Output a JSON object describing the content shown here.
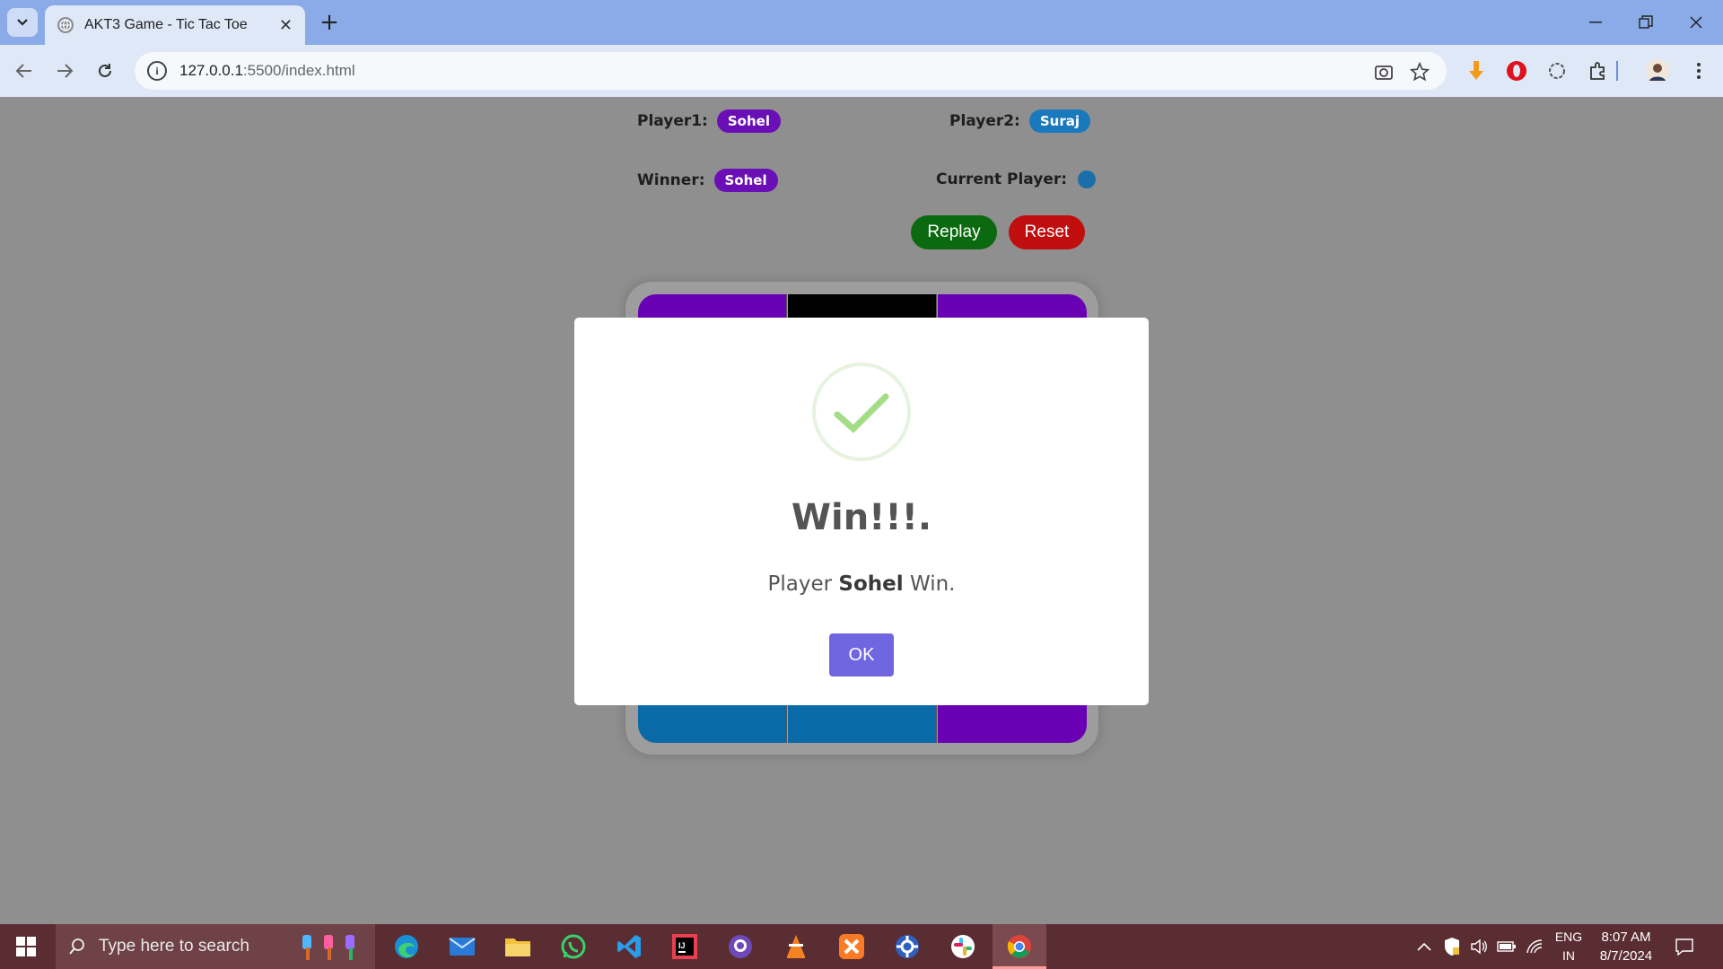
{
  "browser": {
    "tab_title": "AKT3 Game - Tic Tac Toe",
    "url_host": "127.0.0.1",
    "url_rest": ":5500/index.html"
  },
  "game": {
    "player1_label": "Player1:",
    "player1_name": "Sohel",
    "player2_label": "Player2:",
    "player2_name": "Suraj",
    "winner_label": "Winner:",
    "winner_name": "Sohel",
    "current_player_label": "Current Player:",
    "replay_label": "Replay",
    "reset_label": "Reset",
    "board_colors": {
      "player1": "#6a00b3",
      "player2": "#0a6aa8",
      "empty": "#000000"
    }
  },
  "modal": {
    "title": "Win!!!.",
    "text_prefix": "Player ",
    "text_name": "Sohel",
    "text_suffix": " Win.",
    "ok_label": "OK"
  },
  "taskbar": {
    "search_placeholder": "Type here to search",
    "lang_line1": "ENG",
    "lang_line2": "IN",
    "time": "8:07 AM",
    "date": "8/7/2024"
  }
}
